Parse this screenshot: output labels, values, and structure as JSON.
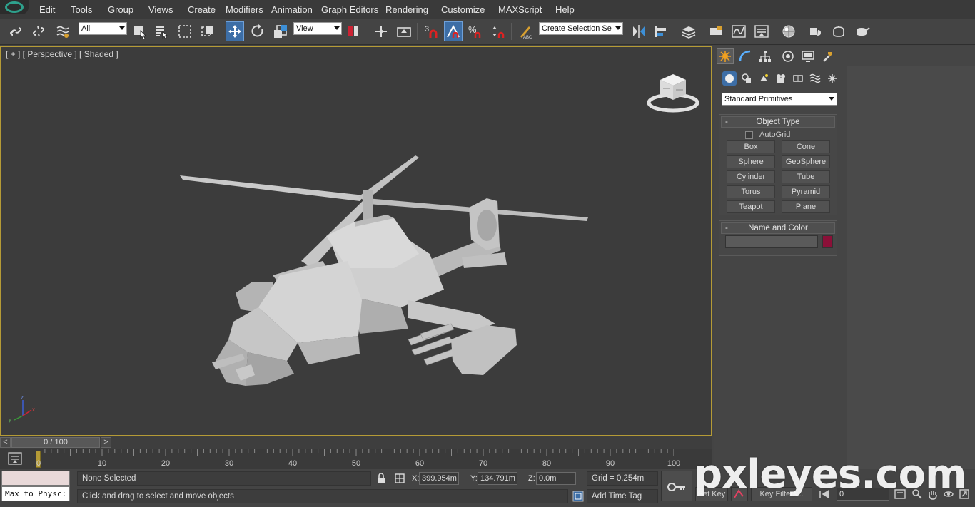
{
  "menu": [
    "Edit",
    "Tools",
    "Group",
    "Views",
    "Create",
    "Modifiers",
    "Animation",
    "Graph Editors",
    "Rendering",
    "Customize",
    "MAXScript",
    "Help"
  ],
  "toolbar": {
    "selection_filter": "All",
    "reference_coord": "View",
    "snap_angle_label": "3",
    "named_selection_placeholder": "Create Selection Se",
    "icons": [
      "link-icon",
      "unlink-icon",
      "bind-space-warp-icon",
      "select-object-icon",
      "select-by-name-icon",
      "rectangular-selection-icon",
      "window-crossing-icon",
      "select-and-move-icon",
      "select-and-rotate-icon",
      "select-and-scale-icon",
      "pivot-icon",
      "keyboard-shortcut-icon",
      "snap-toggle-icon",
      "angle-snap-icon",
      "percent-snap-icon",
      "spinner-snap-icon",
      "edit-named-selection-icon",
      "mirror-icon",
      "align-icon",
      "layer-manager-icon",
      "graphite-ribbon-icon",
      "curve-editor-icon",
      "schematic-view-icon",
      "material-editor-icon",
      "render-setup-icon",
      "rendered-frame-icon",
      "render-production-icon"
    ]
  },
  "viewport": {
    "label": "[ + ] [ Perspective ] [ Shaded ]",
    "axis_labels": [
      "x",
      "y",
      "z"
    ]
  },
  "command_panel": {
    "tabs": [
      "create-tab",
      "modify-tab",
      "hierarchy-tab",
      "motion-tab",
      "display-tab",
      "utilities-tab"
    ],
    "subtabs": [
      "geometry",
      "shapes",
      "lights",
      "cameras",
      "helpers",
      "space-warps",
      "systems"
    ],
    "category_dropdown": "Standard Primitives",
    "object_type": {
      "title": "Object Type",
      "autogrid_label": "AutoGrid",
      "buttons": [
        "Box",
        "Cone",
        "Sphere",
        "GeoSphere",
        "Cylinder",
        "Tube",
        "Torus",
        "Pyramid",
        "Teapot",
        "Plane"
      ]
    },
    "name_and_color": {
      "title": "Name and Color",
      "name_value": "",
      "color": "#8b1038"
    }
  },
  "time_slider": {
    "position": "0 / 100",
    "prev": "<",
    "next": ">"
  },
  "track_bar": {
    "ticks": [
      "0",
      "10",
      "20",
      "30",
      "40",
      "50",
      "60",
      "70",
      "80",
      "90",
      "100"
    ]
  },
  "status": {
    "maxscript_input": "Max to Physc:",
    "selection_info": "None Selected",
    "prompt": "Click and drag to select and move objects",
    "x_label": "X:",
    "x_value": "399.954m",
    "y_label": "Y:",
    "y_value": "134.791m",
    "z_label": "Z:",
    "z_value": "0.0m",
    "grid": "Grid = 0.254m",
    "add_time_tag": "Add Time Tag",
    "set_key": "Set Key",
    "key_filters": "Key Filters...",
    "frame_value": "0"
  },
  "watermark": "pxleyes.com",
  "colors": {
    "accent_active": "#3d6ea6",
    "viewport_border": "#b59b36",
    "brand_ring": "#2ea08c"
  }
}
